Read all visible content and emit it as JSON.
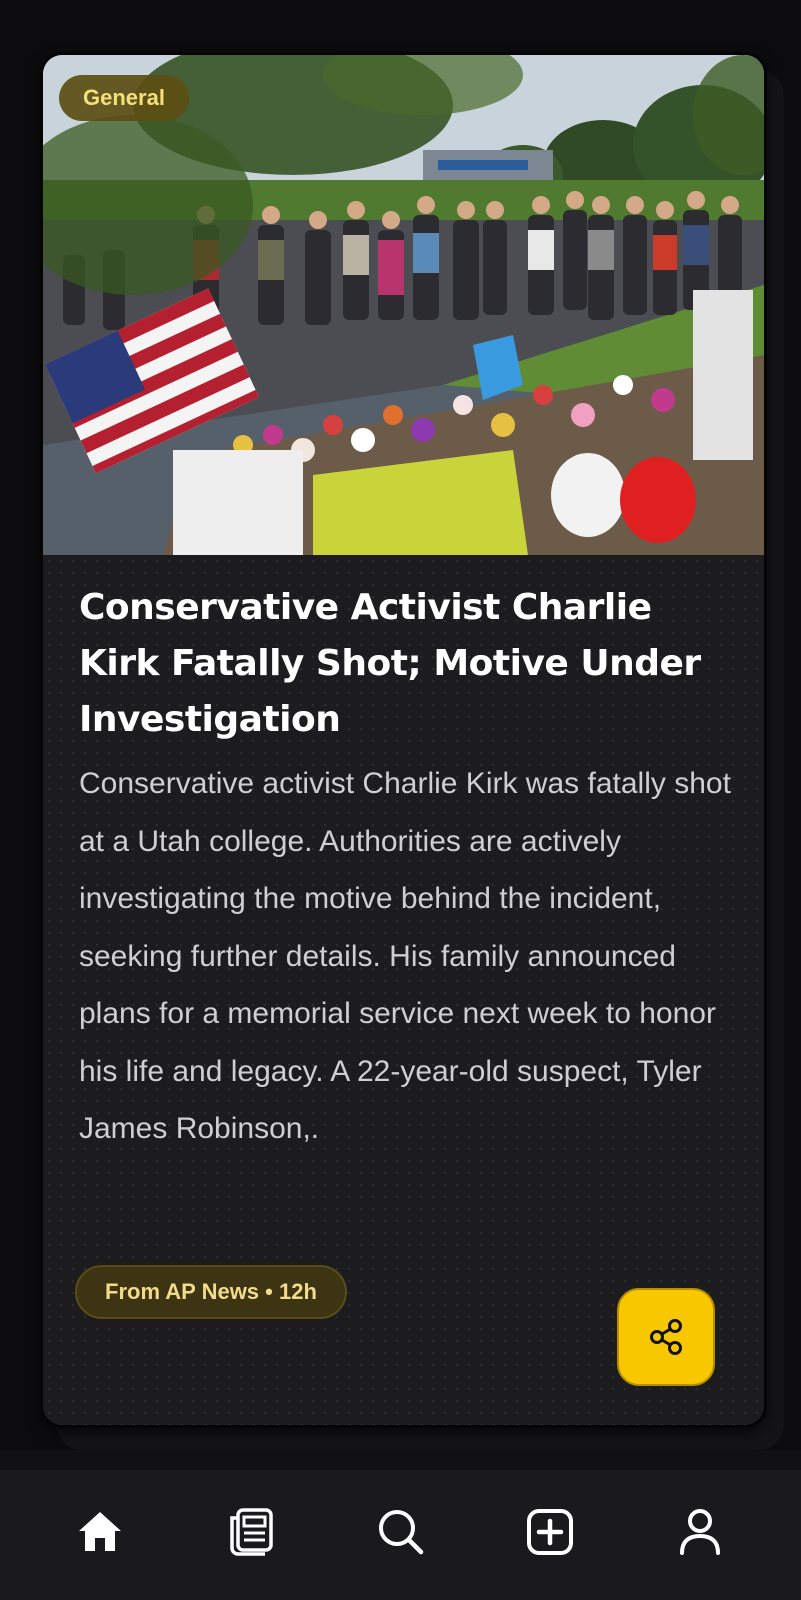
{
  "article": {
    "category": "General",
    "headline": "Conservative Activist Charlie Kirk Fatally Shot; Motive Under Investigation",
    "summary": "Conservative activist Charlie Kirk was fatally shot at a Utah college. Authorities are actively investigating the motive behind the incident, seeking further details. His family announced plans for a memorial service next week to honor his life and legacy. A 22-year-old suspect, Tyler James Robinson,.",
    "source_label": "From AP News • 12h",
    "image_description_icon": "photo"
  },
  "share": {
    "icon": "share-icon"
  },
  "bottom_nav": {
    "items": [
      {
        "icon": "home-icon",
        "active": true
      },
      {
        "icon": "news-icon",
        "active": false
      },
      {
        "icon": "search-icon",
        "active": false
      },
      {
        "icon": "add-icon",
        "active": false
      },
      {
        "icon": "profile-icon",
        "active": false
      }
    ]
  },
  "colors": {
    "background": "#0c0c0e",
    "card": "#1c1c1f",
    "accent": "#f7c800",
    "chip_bg": "#3d3414",
    "chip_text": "#f2dc8a",
    "headline": "#ffffff",
    "body_text": "#cfcfd2"
  }
}
